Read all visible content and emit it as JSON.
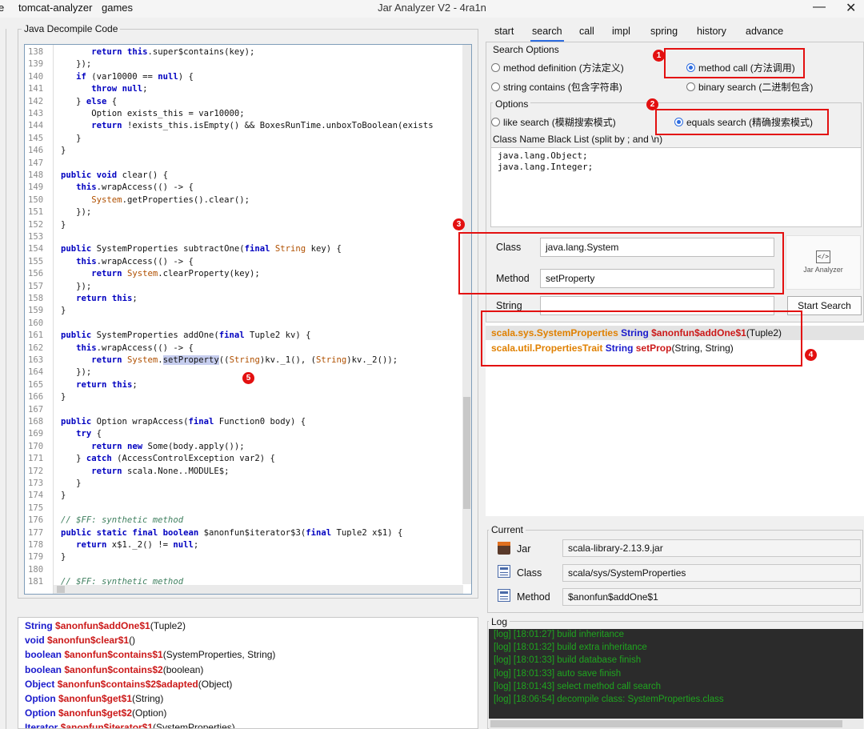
{
  "window": {
    "menu": [
      "e",
      "tomcat-analyzer",
      "games"
    ],
    "title": "Jar Analyzer V2 - 4ra1n",
    "minimize": "—",
    "close": "✕"
  },
  "code_panel": {
    "title": "Java Decompile Code",
    "lines": [
      {
        "n": "138",
        "html": "      <span class=\"kw\">return</span> <span class=\"kw\">this</span>.super$contains(key);"
      },
      {
        "n": "139",
        "html": "   });"
      },
      {
        "n": "140",
        "html": "   <span class=\"kw\">if</span> (var10000 == <span class=\"kw\">null</span>) {"
      },
      {
        "n": "141",
        "html": "      <span class=\"kw\">throw</span> <span class=\"kw\">null</span>;"
      },
      {
        "n": "142",
        "html": "   } <span class=\"kw\">else</span> {"
      },
      {
        "n": "143",
        "html": "      Option exists_this = var10000;"
      },
      {
        "n": "144",
        "html": "      <span class=\"kw\">return</span> !exists_this.isEmpty() &amp;&amp; BoxesRunTime.unboxToBoolean(exists"
      },
      {
        "n": "145",
        "html": "   }"
      },
      {
        "n": "146",
        "html": "}"
      },
      {
        "n": "147",
        "html": ""
      },
      {
        "n": "148",
        "html": "<span class=\"kw\">public</span> <span class=\"kw\">void</span> clear() {"
      },
      {
        "n": "149",
        "html": "   <span class=\"kw\">this</span>.wrapAccess(() -&gt; {"
      },
      {
        "n": "150",
        "html": "      <span class=\"ty\">System</span>.getProperties().clear();"
      },
      {
        "n": "151",
        "html": "   });"
      },
      {
        "n": "152",
        "html": "}"
      },
      {
        "n": "153",
        "html": ""
      },
      {
        "n": "154",
        "html": "<span class=\"kw\">public</span> SystemProperties subtractOne(<span class=\"kw\">final</span> <span class=\"ty\">String</span> key) {"
      },
      {
        "n": "155",
        "html": "   <span class=\"kw\">this</span>.wrapAccess(() -&gt; {"
      },
      {
        "n": "156",
        "html": "      <span class=\"kw\">return</span> <span class=\"ty\">System</span>.clearProperty(key);"
      },
      {
        "n": "157",
        "html": "   });"
      },
      {
        "n": "158",
        "html": "   <span class=\"kw\">return</span> <span class=\"kw\">this</span>;"
      },
      {
        "n": "159",
        "html": "}"
      },
      {
        "n": "160",
        "html": ""
      },
      {
        "n": "161",
        "html": "<span class=\"kw\">public</span> SystemProperties addOne(<span class=\"kw\">final</span> Tuple2 kv) {"
      },
      {
        "n": "162",
        "html": "   <span class=\"kw\">this</span>.wrapAccess(() -&gt; {"
      },
      {
        "n": "163",
        "html": "      <span class=\"kw\">return</span> <span class=\"ty\">System</span>.<span class=\"hl\">setProperty</span>((<span class=\"ty\">String</span>)kv._1(), (<span class=\"ty\">String</span>)kv._2());"
      },
      {
        "n": "164",
        "html": "   });"
      },
      {
        "n": "165",
        "html": "   <span class=\"kw\">return</span> <span class=\"kw\">this</span>;"
      },
      {
        "n": "166",
        "html": "}"
      },
      {
        "n": "167",
        "html": ""
      },
      {
        "n": "168",
        "html": "<span class=\"kw\">public</span> Option wrapAccess(<span class=\"kw\">final</span> Function0 body) {"
      },
      {
        "n": "169",
        "html": "   <span class=\"kw\">try</span> {"
      },
      {
        "n": "170",
        "html": "      <span class=\"kw\">return</span> <span class=\"kw\">new</span> Some(body.apply());"
      },
      {
        "n": "171",
        "html": "   } <span class=\"kw\">catch</span> (AccessControlException var2) {"
      },
      {
        "n": "172",
        "html": "      <span class=\"kw\">return</span> scala.None..MODULE$;"
      },
      {
        "n": "173",
        "html": "   }"
      },
      {
        "n": "174",
        "html": "}"
      },
      {
        "n": "175",
        "html": ""
      },
      {
        "n": "176",
        "html": "<span class=\"cm\">// $FF: synthetic method</span>"
      },
      {
        "n": "177",
        "html": "<span class=\"kw\">public</span> <span class=\"kw\">static</span> <span class=\"kw\">final</span> <span class=\"kw\">boolean</span> $anonfun$iterator$3(<span class=\"kw\">final</span> Tuple2 x$1) {"
      },
      {
        "n": "178",
        "html": "   <span class=\"kw\">return</span> x$1._2() != <span class=\"kw\">null</span>;"
      },
      {
        "n": "179",
        "html": "}"
      },
      {
        "n": "180",
        "html": ""
      },
      {
        "n": "181",
        "html": "<span class=\"cm\">// $FF: synthetic method</span>"
      }
    ]
  },
  "methods": [
    {
      "ret": "String",
      "name": "$anonfun$addOne$1",
      "params": "(Tuple2)"
    },
    {
      "ret": "void",
      "name": "$anonfun$clear$1",
      "params": "()"
    },
    {
      "ret": "boolean",
      "name": "$anonfun$contains$1",
      "params": "(SystemProperties, String)"
    },
    {
      "ret": "boolean",
      "name": "$anonfun$contains$2",
      "params": "(boolean)"
    },
    {
      "ret": "Object",
      "name": "$anonfun$contains$2$adapted",
      "params": "(Object)"
    },
    {
      "ret": "Option",
      "name": "$anonfun$get$1",
      "params": "(String)"
    },
    {
      "ret": "Option",
      "name": "$anonfun$get$2",
      "params": "(Option)"
    },
    {
      "ret": "Iterator",
      "name": "$anonfun$iterator$1",
      "params": "(SystemProperties)"
    }
  ],
  "tabs": [
    "start",
    "search",
    "call",
    "impl",
    "spring",
    "history",
    "advance"
  ],
  "active_tab": "search",
  "search_options": {
    "title": "Search Options",
    "method_definition": "method definition (方法定义)",
    "method_call": "method call (方法调用)",
    "string_contains": "string contains (包含字符串)",
    "binary_search": "binary search (二进制包含)",
    "selected": "method call"
  },
  "options": {
    "title": "Options",
    "like_search": "like search (模糊搜索模式)",
    "equals_search": "equals search (精确搜索模式)",
    "selected": "equals search",
    "blacklist_label": "Class Name Black List (split by ; and \\n)",
    "blacklist": [
      "java.lang.Object;",
      "java.lang.Integer;"
    ]
  },
  "form": {
    "class_label": "Class",
    "class_value": "java.lang.System",
    "method_label": "Method",
    "method_value": "setProperty",
    "string_label": "String",
    "string_value": "",
    "start_button": "Start Search",
    "logo_text": "Jar Analyzer",
    "logo_glyph": "</>"
  },
  "results": [
    {
      "cls": "scala.sys.SystemProperties",
      "ret": "String",
      "name": "$anonfun$addOne$1",
      "params": "(Tuple2)"
    },
    {
      "cls": "scala.util.PropertiesTrait",
      "ret": "String",
      "name": "setProp",
      "params": "(String, String)"
    }
  ],
  "current": {
    "title": "Current",
    "jar_label": "Jar",
    "jar_value": "scala-library-2.13.9.jar",
    "class_label": "Class",
    "class_value": "scala/sys/SystemProperties",
    "method_label": "Method",
    "method_value": "$anonfun$addOne$1"
  },
  "log": {
    "title": "Log",
    "lines": [
      "[log] [18:01:27] build inheritance",
      "[log] [18:01:32] build extra inheritance",
      "[log] [18:01:33] build database finish",
      "[log] [18:01:33] auto save finish",
      "[log] [18:01:43] select method call search",
      "[log] [18:06:54] decompile class: SystemProperties.class"
    ]
  },
  "annotations": [
    "1",
    "2",
    "3",
    "4",
    "5"
  ],
  "colors": {
    "annotation": "#e31010",
    "keyword": "#0000c0",
    "class_highlight": "#e08000",
    "log_text": "#1fa51f"
  }
}
